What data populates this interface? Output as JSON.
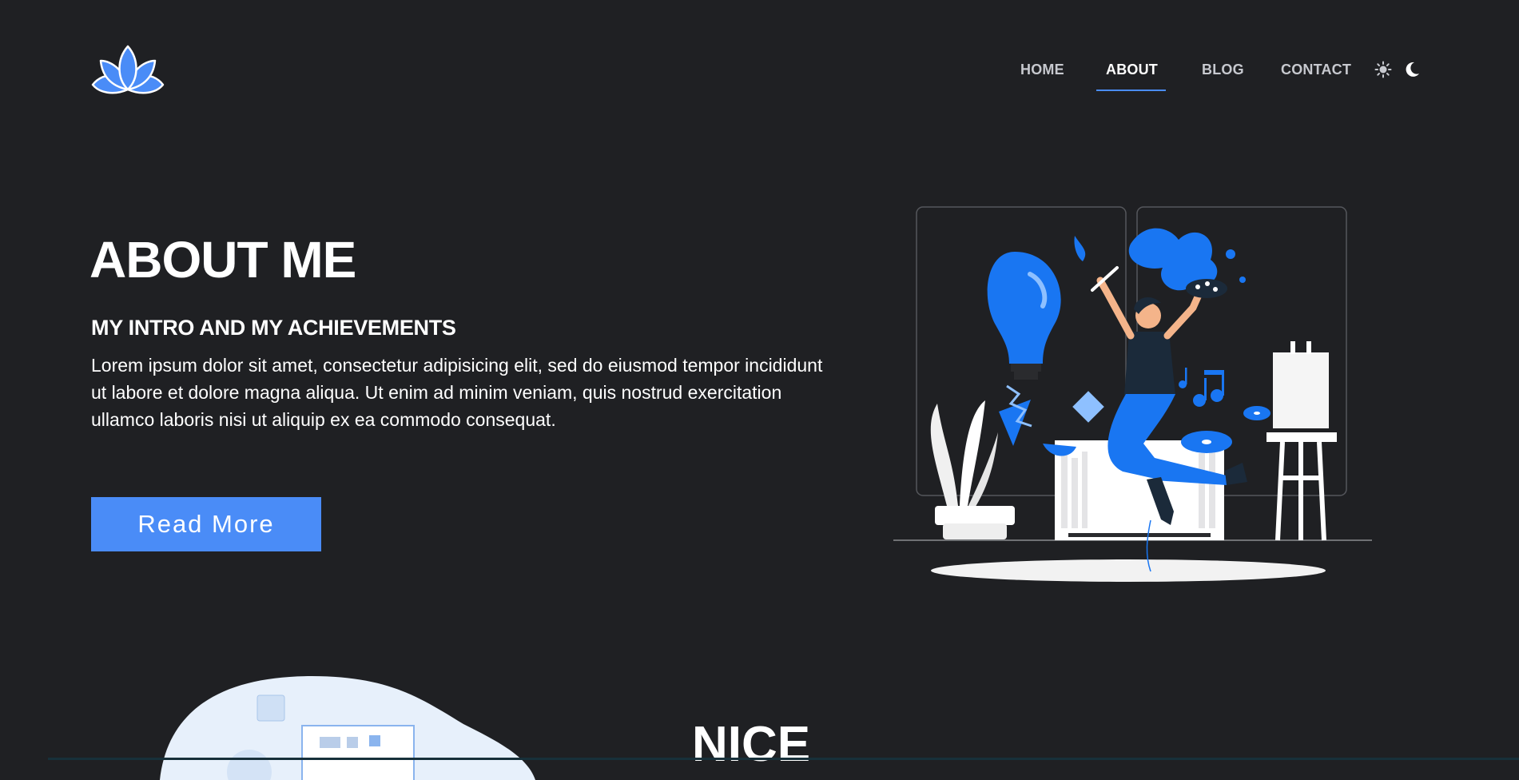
{
  "nav": {
    "items": [
      {
        "label": "HOME"
      },
      {
        "label": "ABOUT"
      },
      {
        "label": "BLOG"
      },
      {
        "label": "CONTACT"
      }
    ],
    "active_item": "ABOUT",
    "theme_icons": [
      "sun-icon",
      "moon-icon"
    ]
  },
  "hero": {
    "title": "ABOUT ME",
    "subtitle": "MY INTRO AND MY ACHIEVEMENTS",
    "body": "Lorem ipsum dolor sit amet, consectetur adipisicing elit, sed do eiusmod tempor incididunt ut labore et dolore magna aliqua. Ut enim ad minim veniam, quis nostrud exercitation ullamco laboris nisi ut aliquip ex ea commodo consequat.",
    "button_label": "Read More"
  },
  "next_section": {
    "title": "NICE"
  },
  "colors": {
    "background": "#1f2023",
    "accent": "#4a8cf7",
    "text": "#ffffff",
    "nav_text": "#c7c9cf"
  }
}
